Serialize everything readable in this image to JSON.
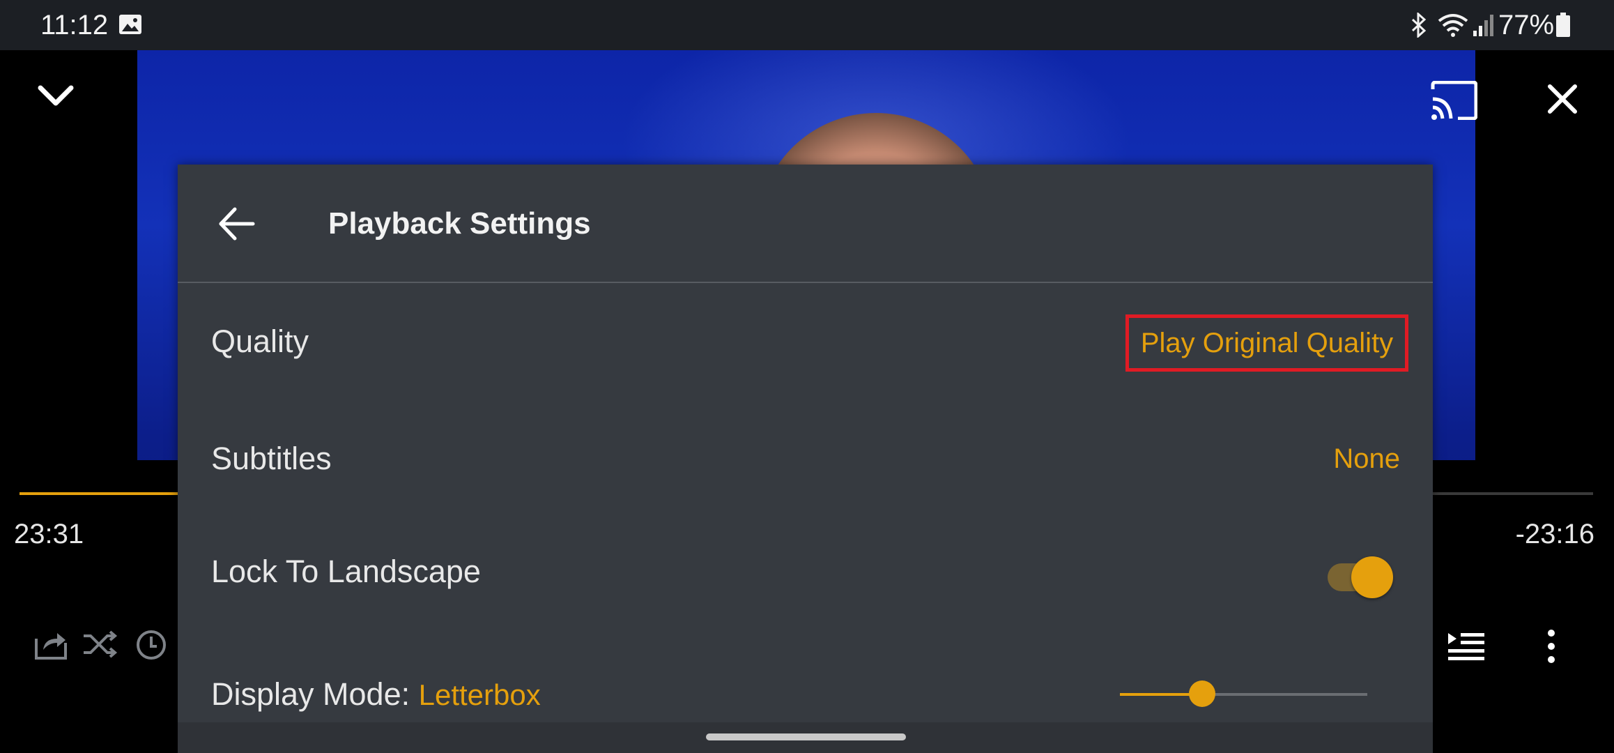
{
  "status_bar": {
    "time": "11:12",
    "battery": "77%",
    "icons": [
      "gallery-icon",
      "bluetooth-icon",
      "wifi-icon",
      "signal-icon",
      "battery-icon"
    ]
  },
  "player": {
    "elapsed": "23:31",
    "remaining": "-23:16",
    "progress": 0.5,
    "top_controls": [
      "chevron-down-icon",
      "cast-icon",
      "close-icon"
    ],
    "bottom_controls": [
      "share-icon",
      "shuffle-icon",
      "timer-icon",
      "queue-icon",
      "more-vert-icon"
    ]
  },
  "settings": {
    "title": "Playback Settings",
    "quality": {
      "label": "Quality",
      "value": "Play Original Quality"
    },
    "subtitles": {
      "label": "Subtitles",
      "value": "None"
    },
    "lock_landscape": {
      "label": "Lock To Landscape",
      "enabled": true
    },
    "display_mode": {
      "label": "Display Mode: ",
      "value": "Letterbox",
      "slider_level": 0.33
    }
  },
  "colors": {
    "accent": "#e5a00d",
    "sheet_bg": "#363a40",
    "highlight_box": "#e01b24"
  }
}
